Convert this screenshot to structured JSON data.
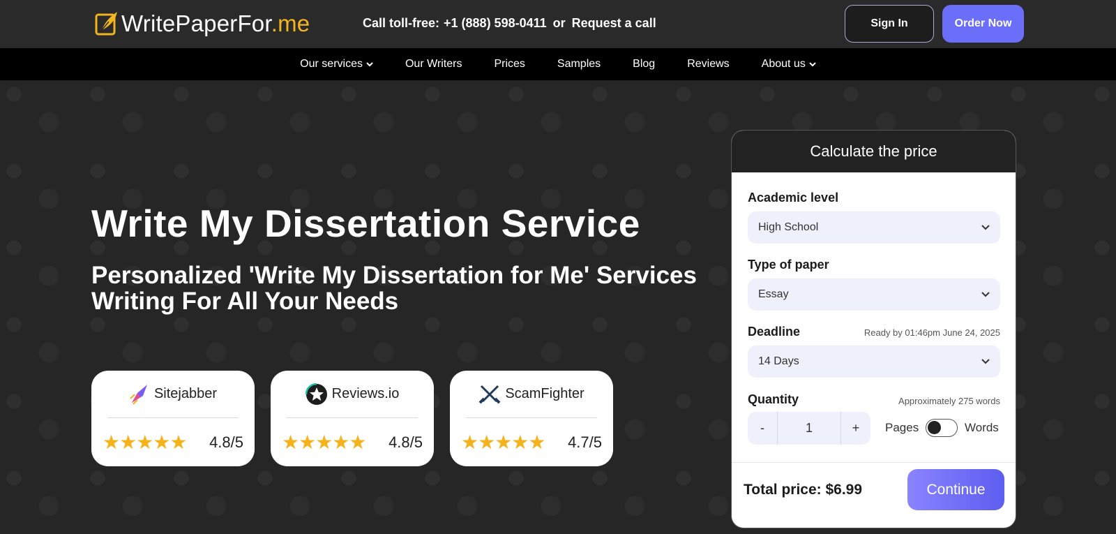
{
  "brand": {
    "name_main": "WritePaperFor",
    "name_accent": ".me",
    "accent_color": "#f2b41f"
  },
  "header": {
    "call_label": "Call toll-free:",
    "phone": "+1 (888) 598-0411",
    "or_text": "or",
    "request_call": "Request a call",
    "sign_in": "Sign In",
    "order_now": "Order Now",
    "order_color": "#6b6ef8"
  },
  "nav": [
    {
      "label": "Our services",
      "dropdown": true
    },
    {
      "label": "Our Writers",
      "dropdown": false
    },
    {
      "label": "Prices",
      "dropdown": false
    },
    {
      "label": "Samples",
      "dropdown": false
    },
    {
      "label": "Blog",
      "dropdown": false
    },
    {
      "label": "Reviews",
      "dropdown": false
    },
    {
      "label": "About us",
      "dropdown": true
    }
  ],
  "hero": {
    "title": "Write My Dissertation Service",
    "subtitle": "Personalized 'Write My Dissertation for Me' Services Writing For All Your Needs"
  },
  "ratings": [
    {
      "name": "Sitejabber",
      "icon": "sitejabber-icon",
      "stars": "★★★★★",
      "score": "4.8/5"
    },
    {
      "name": "Reviews.io",
      "icon": "reviewsio-icon",
      "stars": "★★★★★",
      "score": "4.8/5"
    },
    {
      "name": "ScamFighter",
      "icon": "scamfighter-icon",
      "stars": "★★★★★",
      "score": "4.7/5"
    }
  ],
  "calculator": {
    "title": "Calculate the price",
    "academic_level": {
      "label": "Academic level",
      "value": "High School"
    },
    "paper_type": {
      "label": "Type of paper",
      "value": "Essay"
    },
    "deadline": {
      "label": "Deadline",
      "note": "Ready by 01:46pm June 24, 2025",
      "value": "14 Days"
    },
    "quantity": {
      "label": "Quantity",
      "note": "Approximately 275 words",
      "minus": "-",
      "value": "1",
      "plus": "+",
      "unit_pages": "Pages",
      "unit_words": "Words"
    },
    "total_label": "Total price: $6.99",
    "continue": "Continue"
  }
}
